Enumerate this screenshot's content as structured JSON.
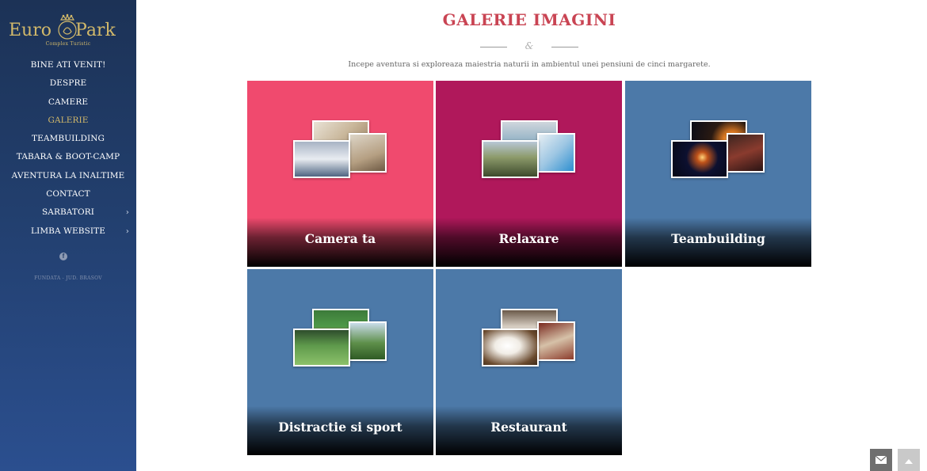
{
  "brand": {
    "name_left": "Euro",
    "name_right": "Park",
    "tagline": "Complex Turistic"
  },
  "nav": [
    {
      "label": "BINE ATI VENIT!",
      "active": false,
      "submenu": false
    },
    {
      "label": "DESPRE",
      "active": false,
      "submenu": false
    },
    {
      "label": "CAMERE",
      "active": false,
      "submenu": false
    },
    {
      "label": "GALERIE",
      "active": true,
      "submenu": false
    },
    {
      "label": "TEAMBUILDING",
      "active": false,
      "submenu": false
    },
    {
      "label": "TABARA & BOOT-CAMP",
      "active": false,
      "submenu": false
    },
    {
      "label": "AVENTURA LA INALTIME",
      "active": false,
      "submenu": false
    },
    {
      "label": "CONTACT",
      "active": false,
      "submenu": false
    },
    {
      "label": "SARBATORI",
      "active": false,
      "submenu": true
    },
    {
      "label": "LIMBA WEBSITE",
      "active": false,
      "submenu": true
    }
  ],
  "social": {
    "facebook_glyph": "f",
    "icon": "facebook-icon"
  },
  "address": "FUNDATA - JUD. BRASOV",
  "page": {
    "title": "GALERIE IMAGINI",
    "divider_glyph": "&",
    "subtitle": "Incepe aventura si exploreaza maiestria naturii in ambientul unei pensiuni de cinci margarete."
  },
  "gallery": [
    {
      "label": "Camera ta",
      "color": "#f04a6e"
    },
    {
      "label": "Relaxare",
      "color": "#b0185b"
    },
    {
      "label": "Teambuilding",
      "color": "#4c79a8"
    },
    {
      "label": "Distractie si sport",
      "color": "#4c79a8"
    },
    {
      "label": "Restaurant",
      "color": "#4c79a8"
    }
  ],
  "colors": {
    "accent_title": "#c94453",
    "sidebar_active": "#d2b96a",
    "logo_gold": "#d2b96a"
  },
  "icons": {
    "mail_button": "envelope-icon",
    "scroll_top_button": "chevron-up-icon",
    "submenu_indicator": "chevron-right-icon"
  }
}
